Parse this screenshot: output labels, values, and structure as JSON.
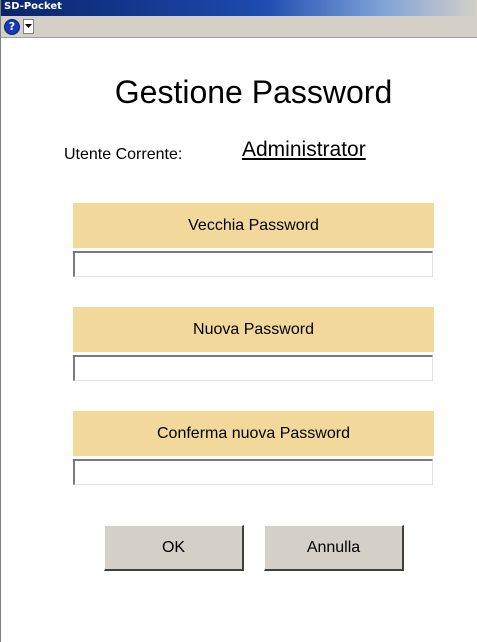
{
  "window": {
    "title": "SD-Pocket"
  },
  "toolbar": {
    "help_icon_glyph": "?",
    "help_icon": "help-icon",
    "dropdown_icon": "chevron-down-icon"
  },
  "main": {
    "heading": "Gestione Password",
    "user_label": "Utente Corrente:",
    "user_value": "Administrator"
  },
  "fields": [
    {
      "label": "Vecchia Password",
      "value": ""
    },
    {
      "label": "Nuova Password",
      "value": ""
    },
    {
      "label": "Conferma nuova Password",
      "value": ""
    }
  ],
  "buttons": {
    "ok": "OK",
    "cancel": "Annulla"
  },
  "colors": {
    "field_label_bg": "#f2d89a",
    "button_bg": "#d4d0c8",
    "titlebar": "#0a246a"
  }
}
